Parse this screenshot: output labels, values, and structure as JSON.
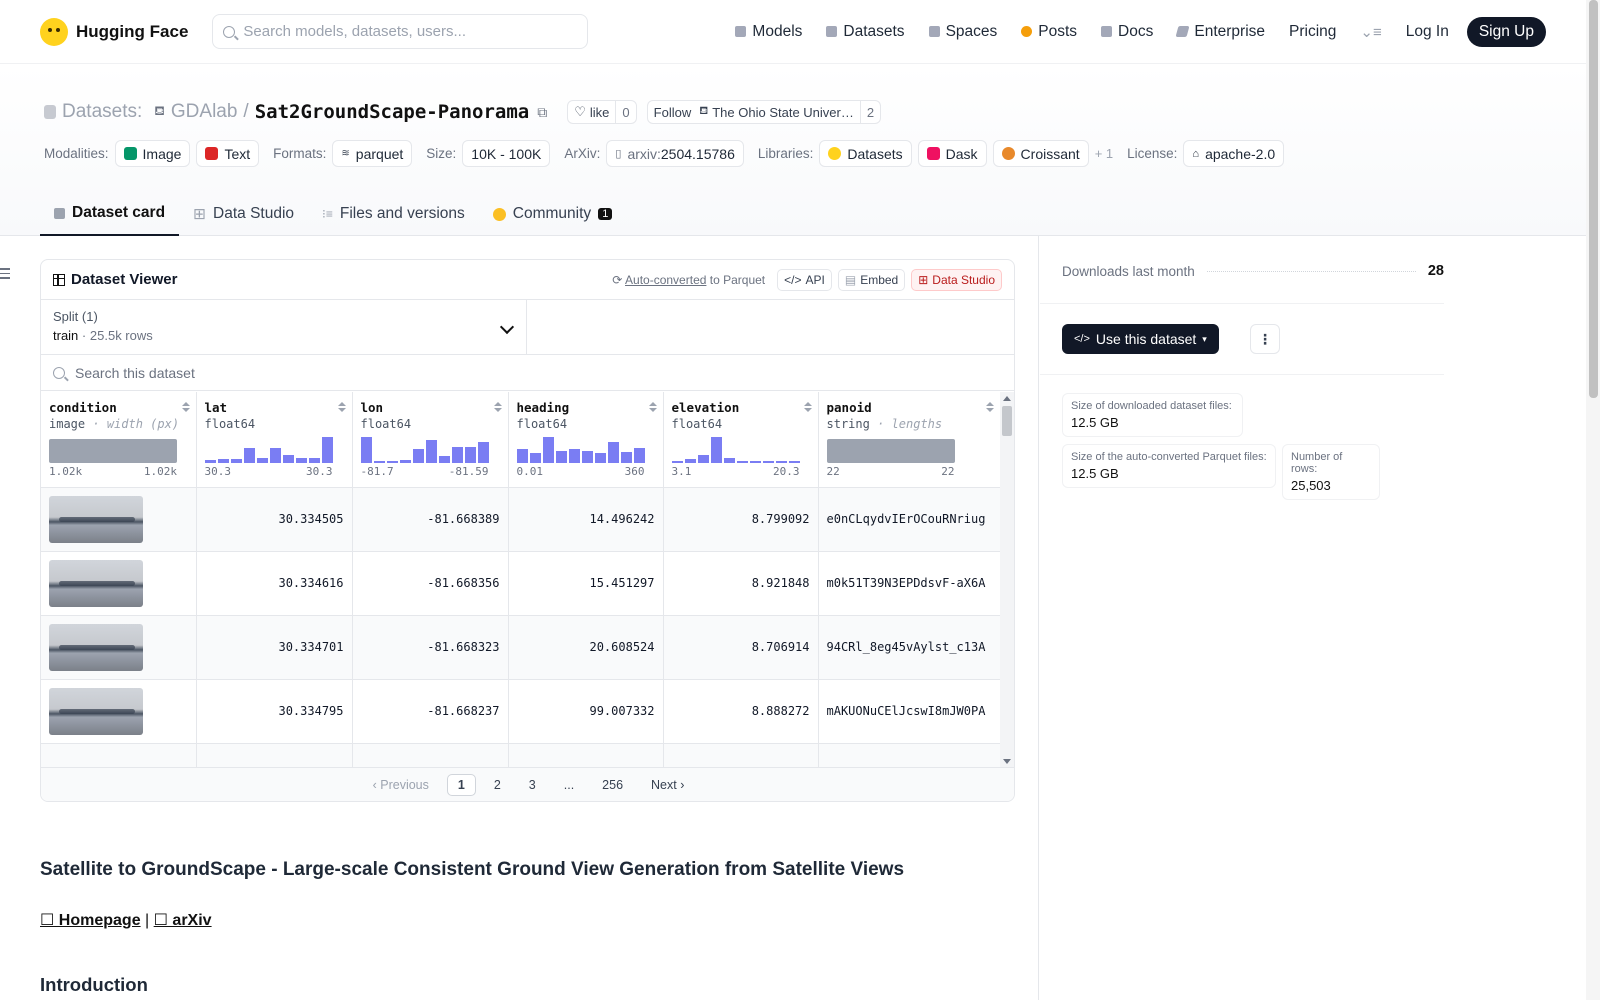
{
  "nav": {
    "brand": "Hugging Face",
    "search_placeholder": "Search models, datasets, users...",
    "links": [
      {
        "label": "Models",
        "icon": "cube-icon",
        "color": "#a3a8b8"
      },
      {
        "label": "Datasets",
        "icon": "database-icon",
        "color": "#a3a8b8"
      },
      {
        "label": "Spaces",
        "icon": "grid-icon",
        "color": "#a3a8b8"
      },
      {
        "label": "Posts",
        "icon": "posts-icon",
        "color": "#f59e0b"
      },
      {
        "label": "Docs",
        "icon": "book-icon",
        "color": "#a3a8b8"
      },
      {
        "label": "Enterprise",
        "icon": "enterprise-icon",
        "color": "#a3a8b8"
      },
      {
        "label": "Pricing"
      }
    ],
    "login": "Log In",
    "signup": "Sign Up"
  },
  "header": {
    "kind": "Datasets:",
    "owner": "GDAlab",
    "sep": "/",
    "name": "Sat2GroundScape-Panorama",
    "like_label": "like",
    "like_count": "0",
    "follow_label": "Follow",
    "org": "The Ohio State Univer…",
    "follow_count": "2",
    "modalities_label": "Modalities:",
    "modalities": [
      "Image",
      "Text"
    ],
    "formats_label": "Formats:",
    "format": "parquet",
    "size_label": "Size:",
    "size": "10K - 100K",
    "arxiv_label": "ArXiv:",
    "arxiv_prefix": "arxiv:",
    "arxiv_id": "2504.15786",
    "libraries_label": "Libraries:",
    "libraries": [
      "Datasets",
      "Dask",
      "Croissant"
    ],
    "libraries_more": "+ 1",
    "license_label": "License:",
    "license": "apache-2.0"
  },
  "tabs": [
    {
      "label": "Dataset card",
      "active": true
    },
    {
      "label": "Data Studio"
    },
    {
      "label": "Files and versions"
    },
    {
      "label": "Community",
      "badge": "1"
    }
  ],
  "viewer": {
    "title": "Dataset Viewer",
    "auto_converted": "Auto-converted",
    "to_parquet": " to Parquet",
    "api": "API",
    "embed": "Embed",
    "studio": "Data Studio",
    "split_label": "Split (1)",
    "split_value": "train",
    "split_dot": "·",
    "split_rows": "25.5k rows",
    "search_placeholder": "Search this dataset",
    "columns": [
      {
        "name": "condition",
        "type": "image",
        "extra": "width (px)",
        "min": "1.02k",
        "max": "1.02k"
      },
      {
        "name": "lat",
        "type": "float64",
        "min": "30.3",
        "max": "30.3",
        "hist": [
          12,
          16,
          16,
          55,
          20,
          55,
          28,
          18,
          20,
          95
        ]
      },
      {
        "name": "lon",
        "type": "float64",
        "min": "-81.7",
        "max": "-81.59",
        "hist": [
          92,
          8,
          4,
          12,
          50,
          80,
          25,
          55,
          55,
          75
        ]
      },
      {
        "name": "heading",
        "type": "float64",
        "min": "0.01",
        "max": "360",
        "hist": [
          50,
          35,
          95,
          45,
          50,
          45,
          35,
          75,
          40,
          55
        ]
      },
      {
        "name": "elevation",
        "type": "float64",
        "min": "3.1",
        "max": "20.3",
        "hist": [
          6,
          15,
          28,
          95,
          20,
          6,
          4,
          4,
          4,
          4
        ]
      },
      {
        "name": "panoid",
        "type": "string",
        "extra": "lengths",
        "min": "22",
        "max": "22"
      }
    ],
    "rows": [
      {
        "lat": "30.334505",
        "lon": "-81.668389",
        "heading": "14.496242",
        "elevation": "8.799092",
        "panoid": "e0nCLqydvIErOCouRNriug"
      },
      {
        "lat": "30.334616",
        "lon": "-81.668356",
        "heading": "15.451297",
        "elevation": "8.921848",
        "panoid": "m0k51T39N3EPDdsvF-aX6A"
      },
      {
        "lat": "30.334701",
        "lon": "-81.668323",
        "heading": "20.608524",
        "elevation": "8.706914",
        "panoid": "94CRl_8eg45vAylst_c13A"
      },
      {
        "lat": "30.334795",
        "lon": "-81.668237",
        "heading": "99.007332",
        "elevation": "8.888272",
        "panoid": "mAKUONuCElJcswI8mJW0PA"
      }
    ],
    "pager": {
      "prev": "Previous",
      "pages": [
        "1",
        "2",
        "3",
        "...",
        "256"
      ],
      "next": "Next",
      "current": "1"
    }
  },
  "card": {
    "title": "Satellite to GroundScape - Large-scale Consistent Ground View Generation from Satellite Views",
    "homepage": "☐ Homepage",
    "link_sep": " | ",
    "arxiv": "☐ arXiv",
    "intro": "Introduction"
  },
  "sidebar": {
    "downloads_label": "Downloads last month",
    "downloads": "28",
    "use_button": "Use this dataset",
    "more": "⋮",
    "stats": [
      {
        "label": "Size of downloaded dataset files:",
        "value": "12.5 GB"
      },
      {
        "label": "Size of the auto-converted Parquet files:",
        "value": "12.5 GB"
      },
      {
        "label": "Number of rows:",
        "value": "25,503"
      }
    ]
  }
}
